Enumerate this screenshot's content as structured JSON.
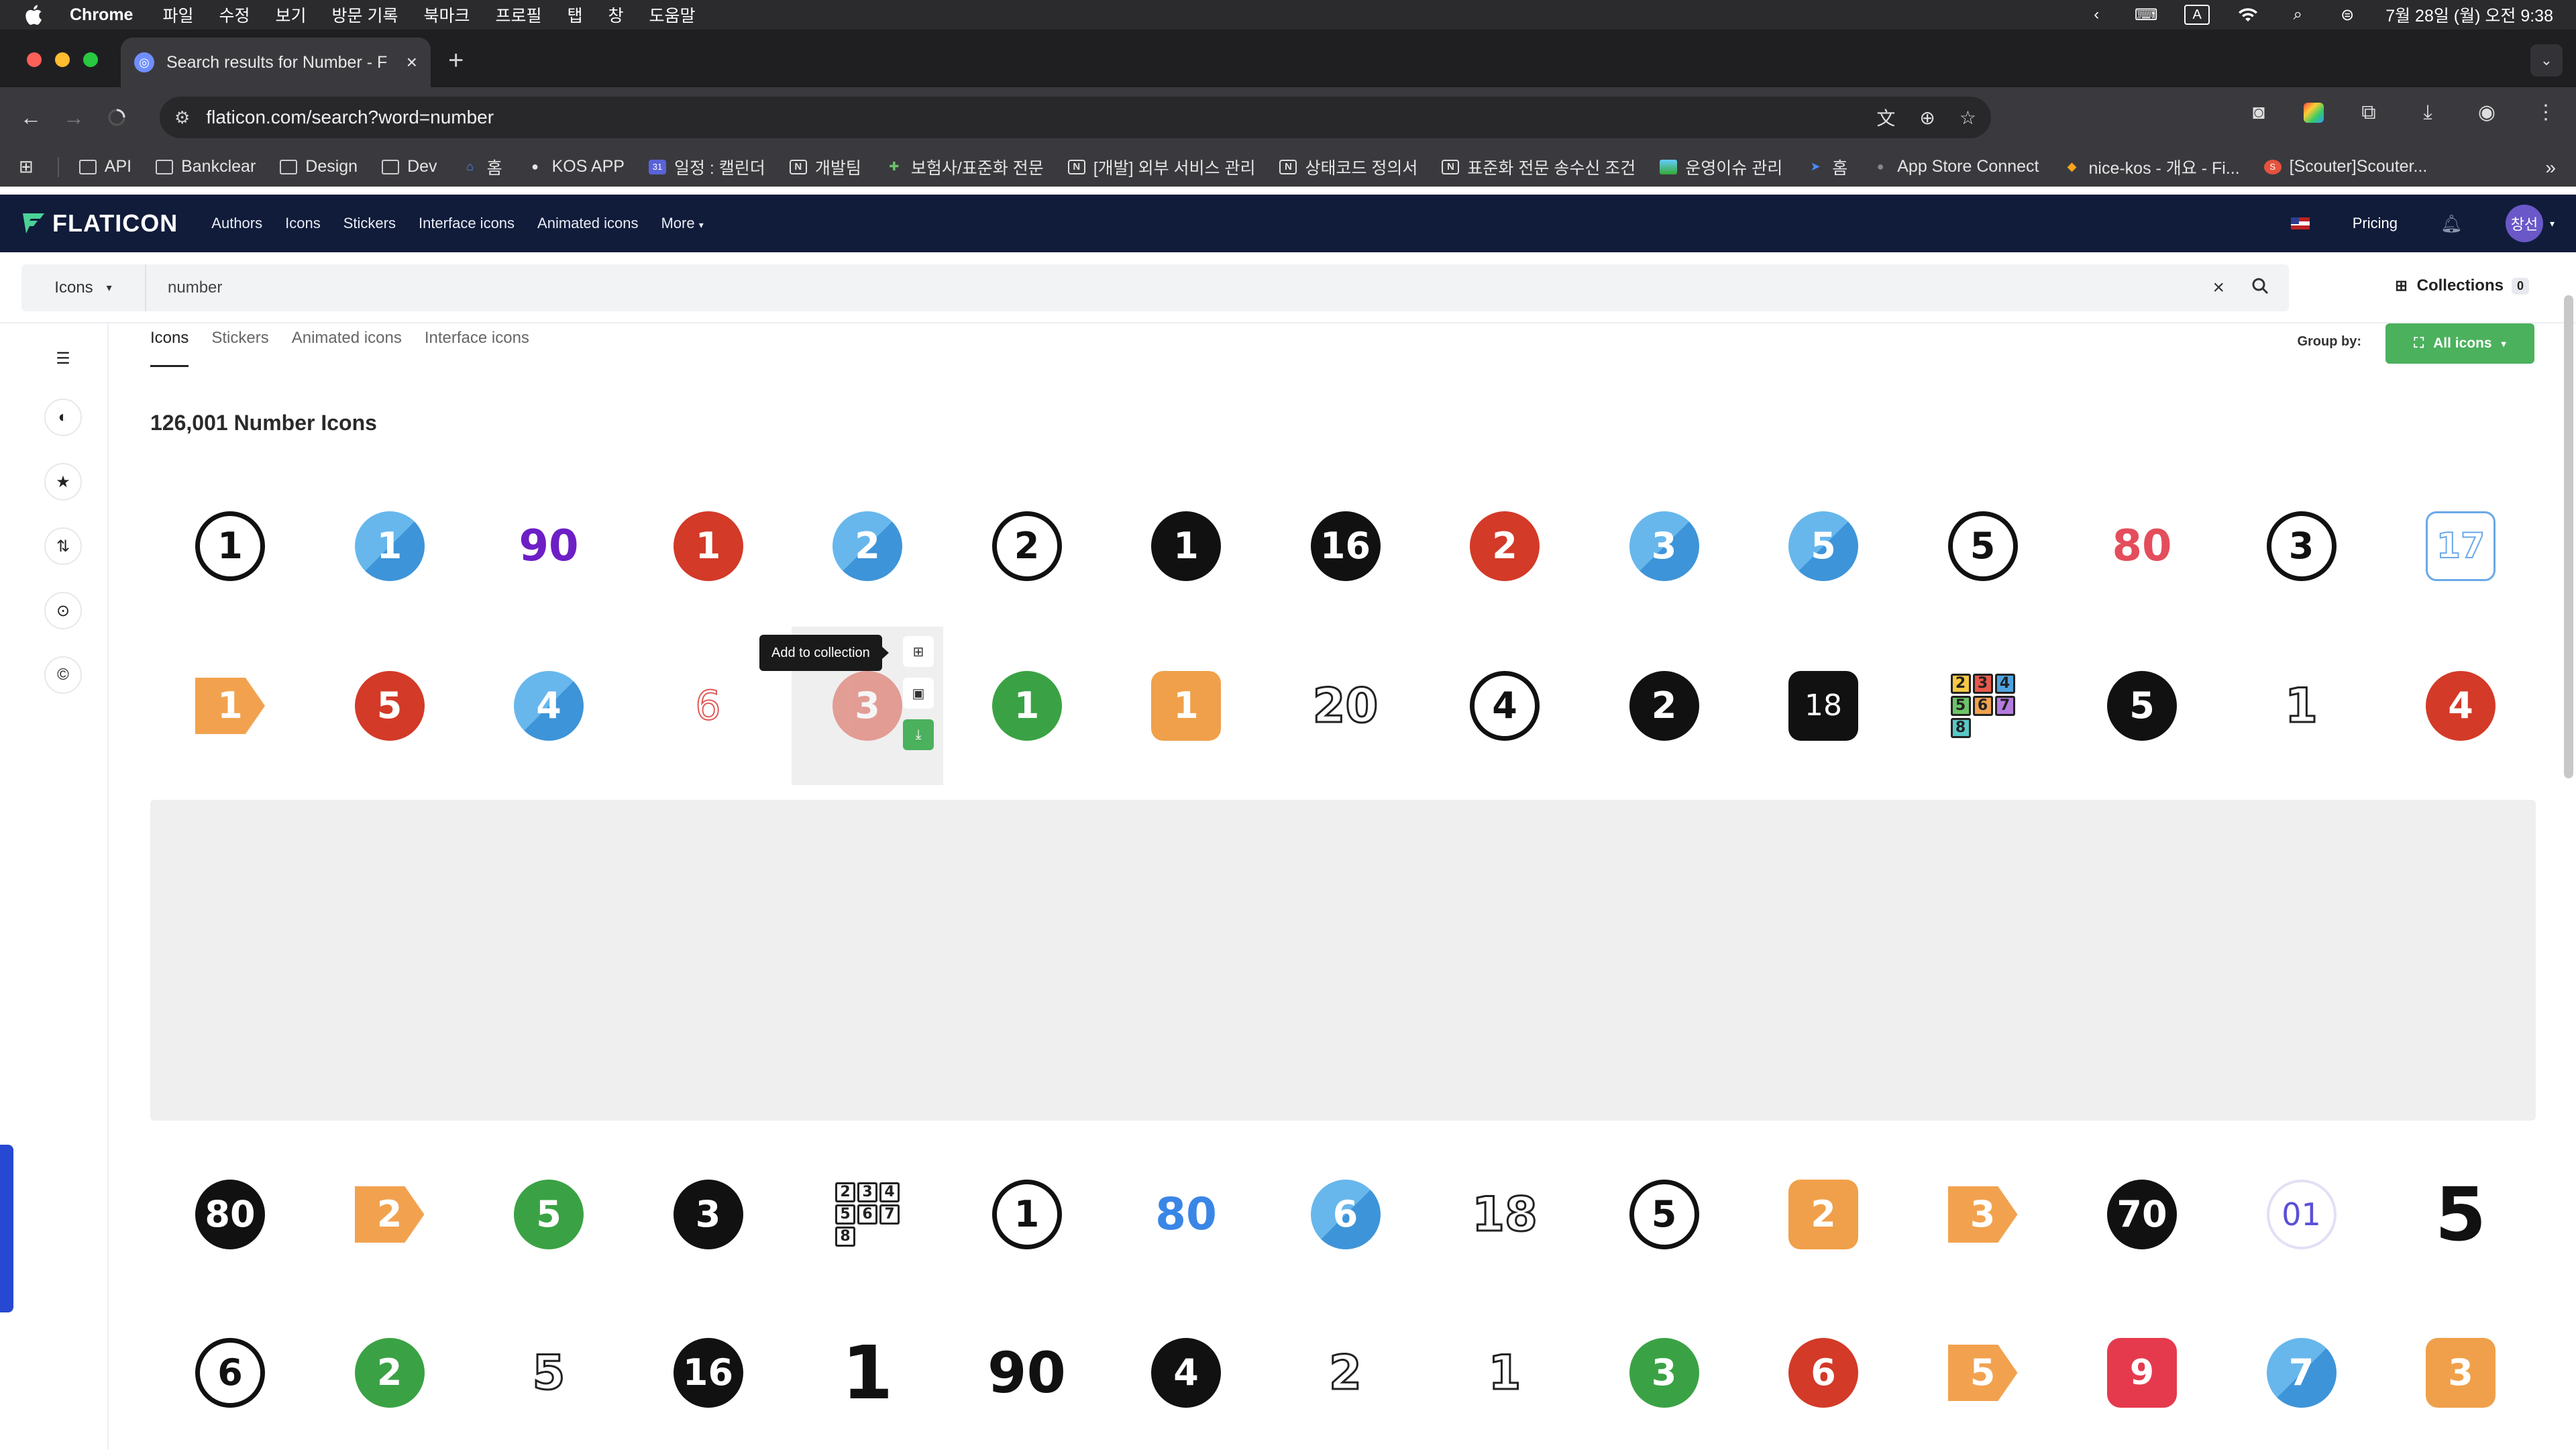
{
  "menubar": {
    "app": "Chrome",
    "items": [
      "파일",
      "수정",
      "보기",
      "방문 기록",
      "북마크",
      "프로필",
      "탭",
      "창",
      "도움말"
    ],
    "input_indicator": "A",
    "datetime": "7월 28일 (월) 오전 9:38"
  },
  "browser": {
    "tab_title": "Search results for Number - F",
    "url": "flaticon.com/search?word=number"
  },
  "bookmarks": [
    {
      "label": "API",
      "icon": "folder-icon"
    },
    {
      "label": "Bankclear",
      "icon": "folder-icon"
    },
    {
      "label": "Design",
      "icon": "folder-icon"
    },
    {
      "label": "Dev",
      "icon": "folder-icon"
    },
    {
      "label": "홈",
      "icon": "home-icon"
    },
    {
      "label": "KOS APP",
      "icon": "bullet-icon"
    },
    {
      "label": "일정 : 캘린더",
      "icon": "calendar-icon"
    },
    {
      "label": "개발팀",
      "icon": "notion-icon"
    },
    {
      "label": "보험사/표준화 전문",
      "icon": "puzzle-icon"
    },
    {
      "label": "[개발] 외부 서비스 관리",
      "icon": "notion-icon"
    },
    {
      "label": "상태코드 정의서",
      "icon": "notion-icon"
    },
    {
      "label": "표준화 전문 송수신 조건",
      "icon": "notion-icon"
    },
    {
      "label": "운영이슈 관리",
      "icon": "image-icon"
    },
    {
      "label": "홈",
      "icon": "arrow-icon"
    },
    {
      "label": "App Store Connect",
      "icon": "apple-icon"
    },
    {
      "label": "nice-kos - 개요 - Fi...",
      "icon": "fire-icon"
    },
    {
      "label": "[Scouter]Scouter...",
      "icon": "scouter-icon"
    }
  ],
  "site": {
    "logo": "FLATICON",
    "nav": [
      "Authors",
      "Icons",
      "Stickers",
      "Interface icons",
      "Animated icons",
      "More"
    ],
    "pricing": "Pricing",
    "avatar": "창선"
  },
  "search": {
    "type": "Icons",
    "query": "number",
    "collections_label": "Collections",
    "collections_count": "0"
  },
  "content": {
    "tabs": [
      "Icons",
      "Stickers",
      "Animated icons",
      "Interface icons"
    ],
    "group_by_label": "Group by:",
    "group_by_value": "All icons",
    "result_count": "126,001 Number Icons",
    "tooltip": "Add to collection"
  },
  "icons": {
    "row1": [
      {
        "text": "1",
        "style": "ring"
      },
      {
        "text": "1",
        "style": "blue"
      },
      {
        "text": "90",
        "style": "purple"
      },
      {
        "text": "1",
        "style": "red"
      },
      {
        "text": "2",
        "style": "blue"
      },
      {
        "text": "2",
        "style": "ring"
      },
      {
        "text": "1",
        "style": "black"
      },
      {
        "text": "16",
        "style": "black"
      },
      {
        "text": "2",
        "style": "red"
      },
      {
        "text": "3",
        "style": "blue"
      },
      {
        "text": "5",
        "style": "blue"
      },
      {
        "text": "5",
        "style": "ring"
      },
      {
        "text": "80",
        "style": "pinkred"
      },
      {
        "text": "3",
        "style": "ring"
      },
      {
        "text": "17",
        "style": "sq-outline"
      }
    ],
    "row2": [
      {
        "text": "1",
        "style": "tag"
      },
      {
        "text": "5",
        "style": "red"
      },
      {
        "text": "4",
        "style": "blue"
      },
      {
        "text": "6",
        "style": "outline-red"
      },
      {
        "text": "3",
        "style": "red"
      },
      {
        "text": "1",
        "style": "green"
      },
      {
        "text": "1",
        "style": "orange"
      },
      {
        "text": "20",
        "style": "outline"
      },
      {
        "text": "4",
        "style": "ring"
      },
      {
        "text": "2",
        "style": "black"
      },
      {
        "text": "18",
        "style": "square-black"
      },
      {
        "text": "2345678",
        "style": "blocks-color"
      },
      {
        "text": "5",
        "style": "black"
      },
      {
        "text": "1",
        "style": "outline"
      },
      {
        "text": "4",
        "style": "red"
      }
    ],
    "row3": [
      {
        "text": "80",
        "style": "black"
      },
      {
        "text": "2",
        "style": "tag"
      },
      {
        "text": "5",
        "style": "green"
      },
      {
        "text": "3",
        "style": "black"
      },
      {
        "text": "2345678",
        "style": "blocks"
      },
      {
        "text": "1",
        "style": "ring"
      },
      {
        "text": "80",
        "style": "bluetext"
      },
      {
        "text": "6",
        "style": "blue"
      },
      {
        "text": "18",
        "style": "outline"
      },
      {
        "text": "5",
        "style": "ring"
      },
      {
        "text": "2",
        "style": "orange"
      },
      {
        "text": "3",
        "style": "tag"
      },
      {
        "text": "70",
        "style": "black"
      },
      {
        "text": "01",
        "style": "dots"
      },
      {
        "text": "5",
        "style": "bigblack"
      }
    ],
    "row4": [
      {
        "text": "6",
        "style": "ring"
      },
      {
        "text": "2",
        "style": "green"
      },
      {
        "text": "5",
        "style": "outline"
      },
      {
        "text": "16",
        "style": "black"
      },
      {
        "text": "1",
        "style": "bigblack"
      },
      {
        "text": "90",
        "style": "bigblack90"
      },
      {
        "text": "4",
        "style": "black"
      },
      {
        "text": "2",
        "style": "outline"
      },
      {
        "text": "1",
        "style": "outline"
      },
      {
        "text": "3",
        "style": "green"
      },
      {
        "text": "6",
        "style": "red"
      },
      {
        "text": "5",
        "style": "tag"
      },
      {
        "text": "9",
        "style": "redsquare"
      },
      {
        "text": "7",
        "style": "blue"
      },
      {
        "text": "3",
        "style": "orange"
      }
    ]
  }
}
